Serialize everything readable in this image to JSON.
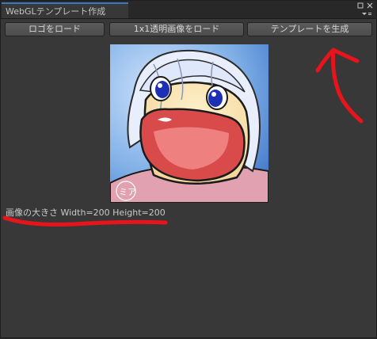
{
  "window": {
    "tab_title": "WebGLテンプレート作成",
    "menu_icon": "kebab-menu-icon",
    "maximize_icon": "maximize-icon"
  },
  "toolbar": {
    "load_logo_label": "ロゴをロード",
    "load_transparent_label": "1x1透明画像をロード",
    "generate_template_label": "テンプレートを生成"
  },
  "preview": {
    "signature_text": "ミア"
  },
  "info": {
    "size_text": "画像の大きさ Width=200 Height=200"
  },
  "colors": {
    "window_bg": "#383838",
    "accent_tab": "#3a79bb",
    "annotation_red": "#e8141c"
  }
}
